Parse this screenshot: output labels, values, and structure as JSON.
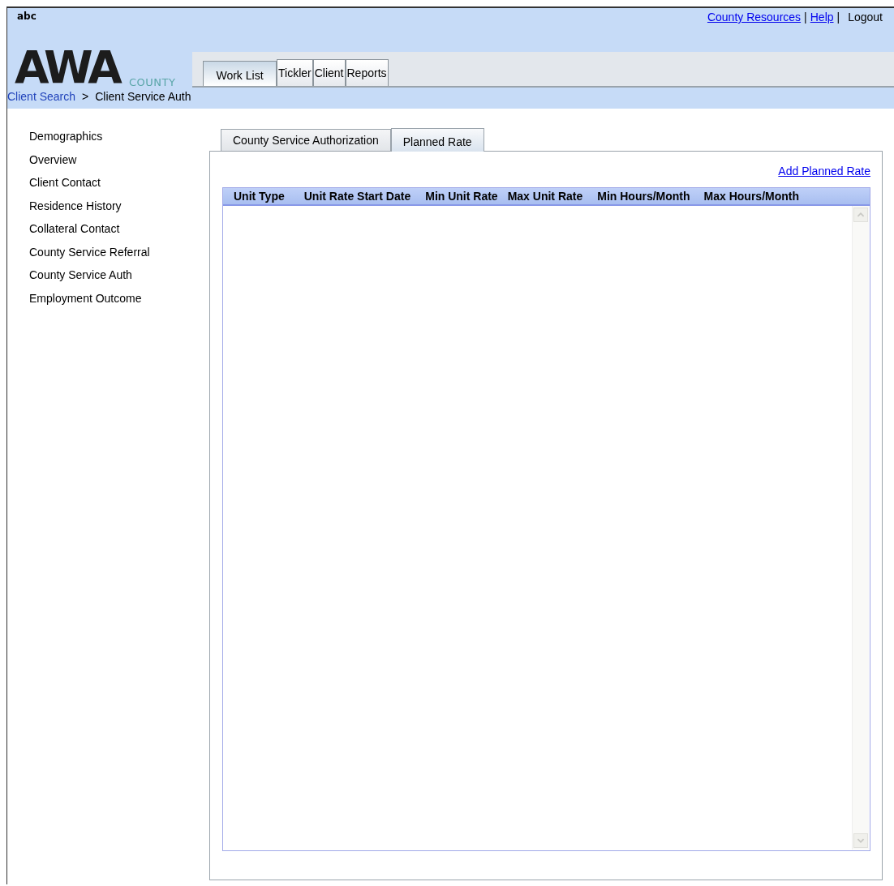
{
  "user": "abc",
  "top_links": [
    {
      "label": "County Resources",
      "kind": "link"
    },
    {
      "label": "Help",
      "kind": "link"
    },
    {
      "label": "Logout",
      "kind": "text"
    }
  ],
  "link_separator": "|",
  "breadcrumb_separator": ">",
  "logo": {
    "mark": "AWA",
    "sub": "COUNTY"
  },
  "main_tabs": [
    {
      "label": "Work List",
      "selected": true
    },
    {
      "label": "Tickler",
      "selected": false
    },
    {
      "label": "Client",
      "selected": false
    },
    {
      "label": "Reports",
      "selected": false
    }
  ],
  "breadcrumb": [
    {
      "label": "Client Search",
      "kind": "link"
    },
    {
      "label": "Client Service Auth",
      "kind": "current"
    }
  ],
  "sidebar": {
    "items": [
      "Demographics",
      "Overview",
      "Client Contact",
      "Residence History",
      "Collateral Contact",
      "County Service Referral",
      "County Service Auth",
      "Employment Outcome"
    ]
  },
  "sub_tabs": [
    {
      "label": "County Service Authorization",
      "selected": false
    },
    {
      "label": "Planned Rate",
      "selected": true
    }
  ],
  "add_link": "Add Planned Rate",
  "table": {
    "columns": [
      "Unit Type",
      "Unit Rate Start Date",
      "Min Unit Rate",
      "Max Unit Rate",
      "Min Hours/Month",
      "Max Hours/Month"
    ]
  }
}
